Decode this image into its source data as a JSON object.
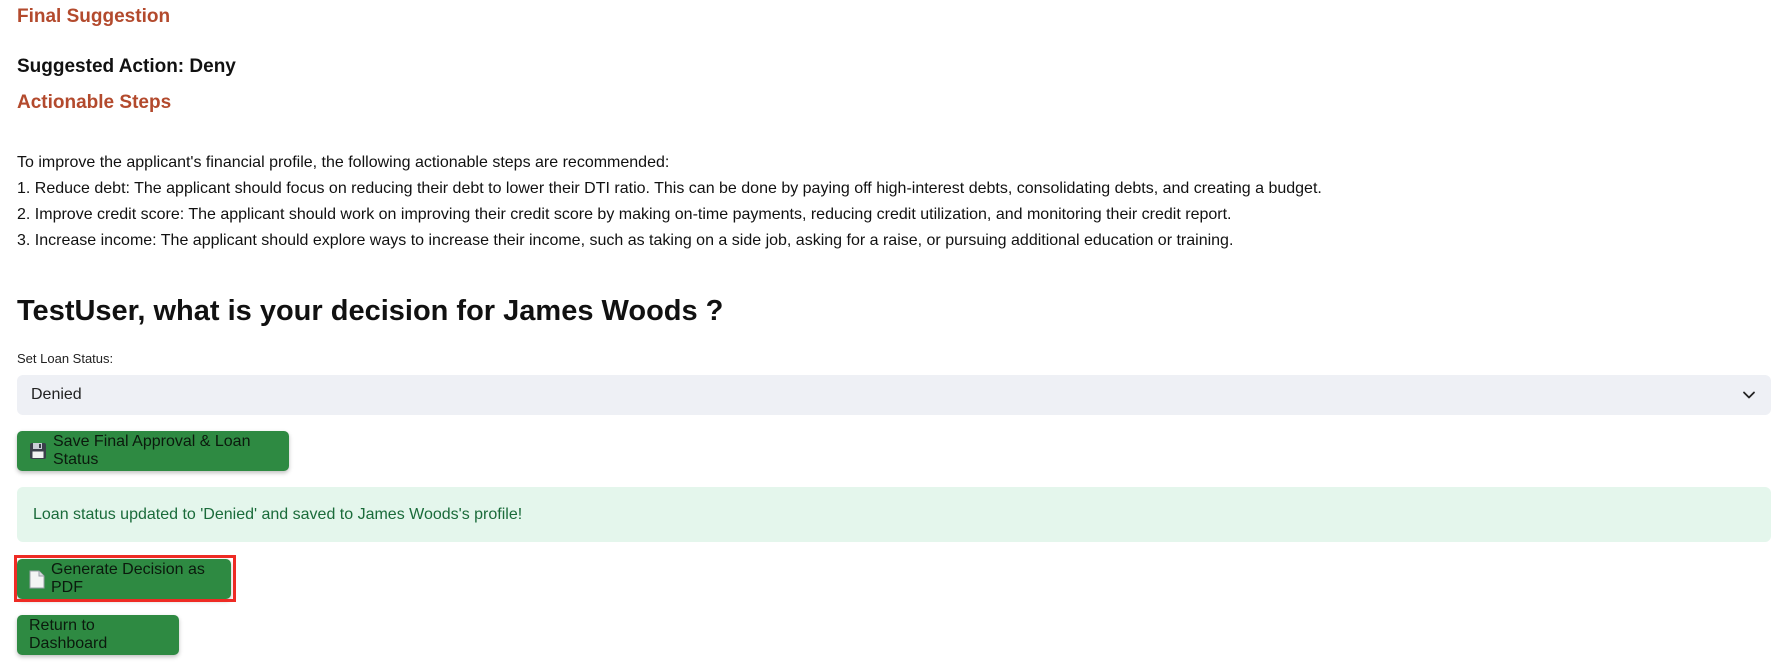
{
  "final_suggestion": {
    "heading": "Final Suggestion",
    "suggested_action": "Suggested Action: Deny"
  },
  "actionable_steps": {
    "heading": "Actionable Steps",
    "intro": "To improve the applicant's financial profile, the following actionable steps are recommended:",
    "items": [
      "1. Reduce debt: The applicant should focus on reducing their debt to lower their DTI ratio. This can be done by paying off high-interest debts, consolidating debts, and creating a budget.",
      "2. Improve credit score: The applicant should work on improving their credit score by making on-time payments, reducing credit utilization, and monitoring their credit report.",
      "3. Increase income: The applicant should explore ways to increase their income, such as taking on a side job, asking for a raise, or pursuing additional education or training."
    ]
  },
  "decision": {
    "question": "TestUser, what is your decision for James Woods ?",
    "select_label": "Set Loan Status:",
    "select_value": "Denied",
    "save_button": "Save Final Approval & Loan Status",
    "success_message": "Loan status updated to 'Denied' and saved to James Woods's profile!",
    "pdf_button": "Generate Decision as PDF",
    "return_button": "Return to Dashboard"
  },
  "colors": {
    "heading_accent": "#b34a2d",
    "button_green": "#2e8a42",
    "success_bg": "#e4f6ec",
    "success_text": "#1a6b3a",
    "highlight_red": "#ee2b24"
  },
  "icons": {
    "save_button": "floppy-disk-icon",
    "pdf_button": "document-icon",
    "select": "chevron-down-icon"
  }
}
